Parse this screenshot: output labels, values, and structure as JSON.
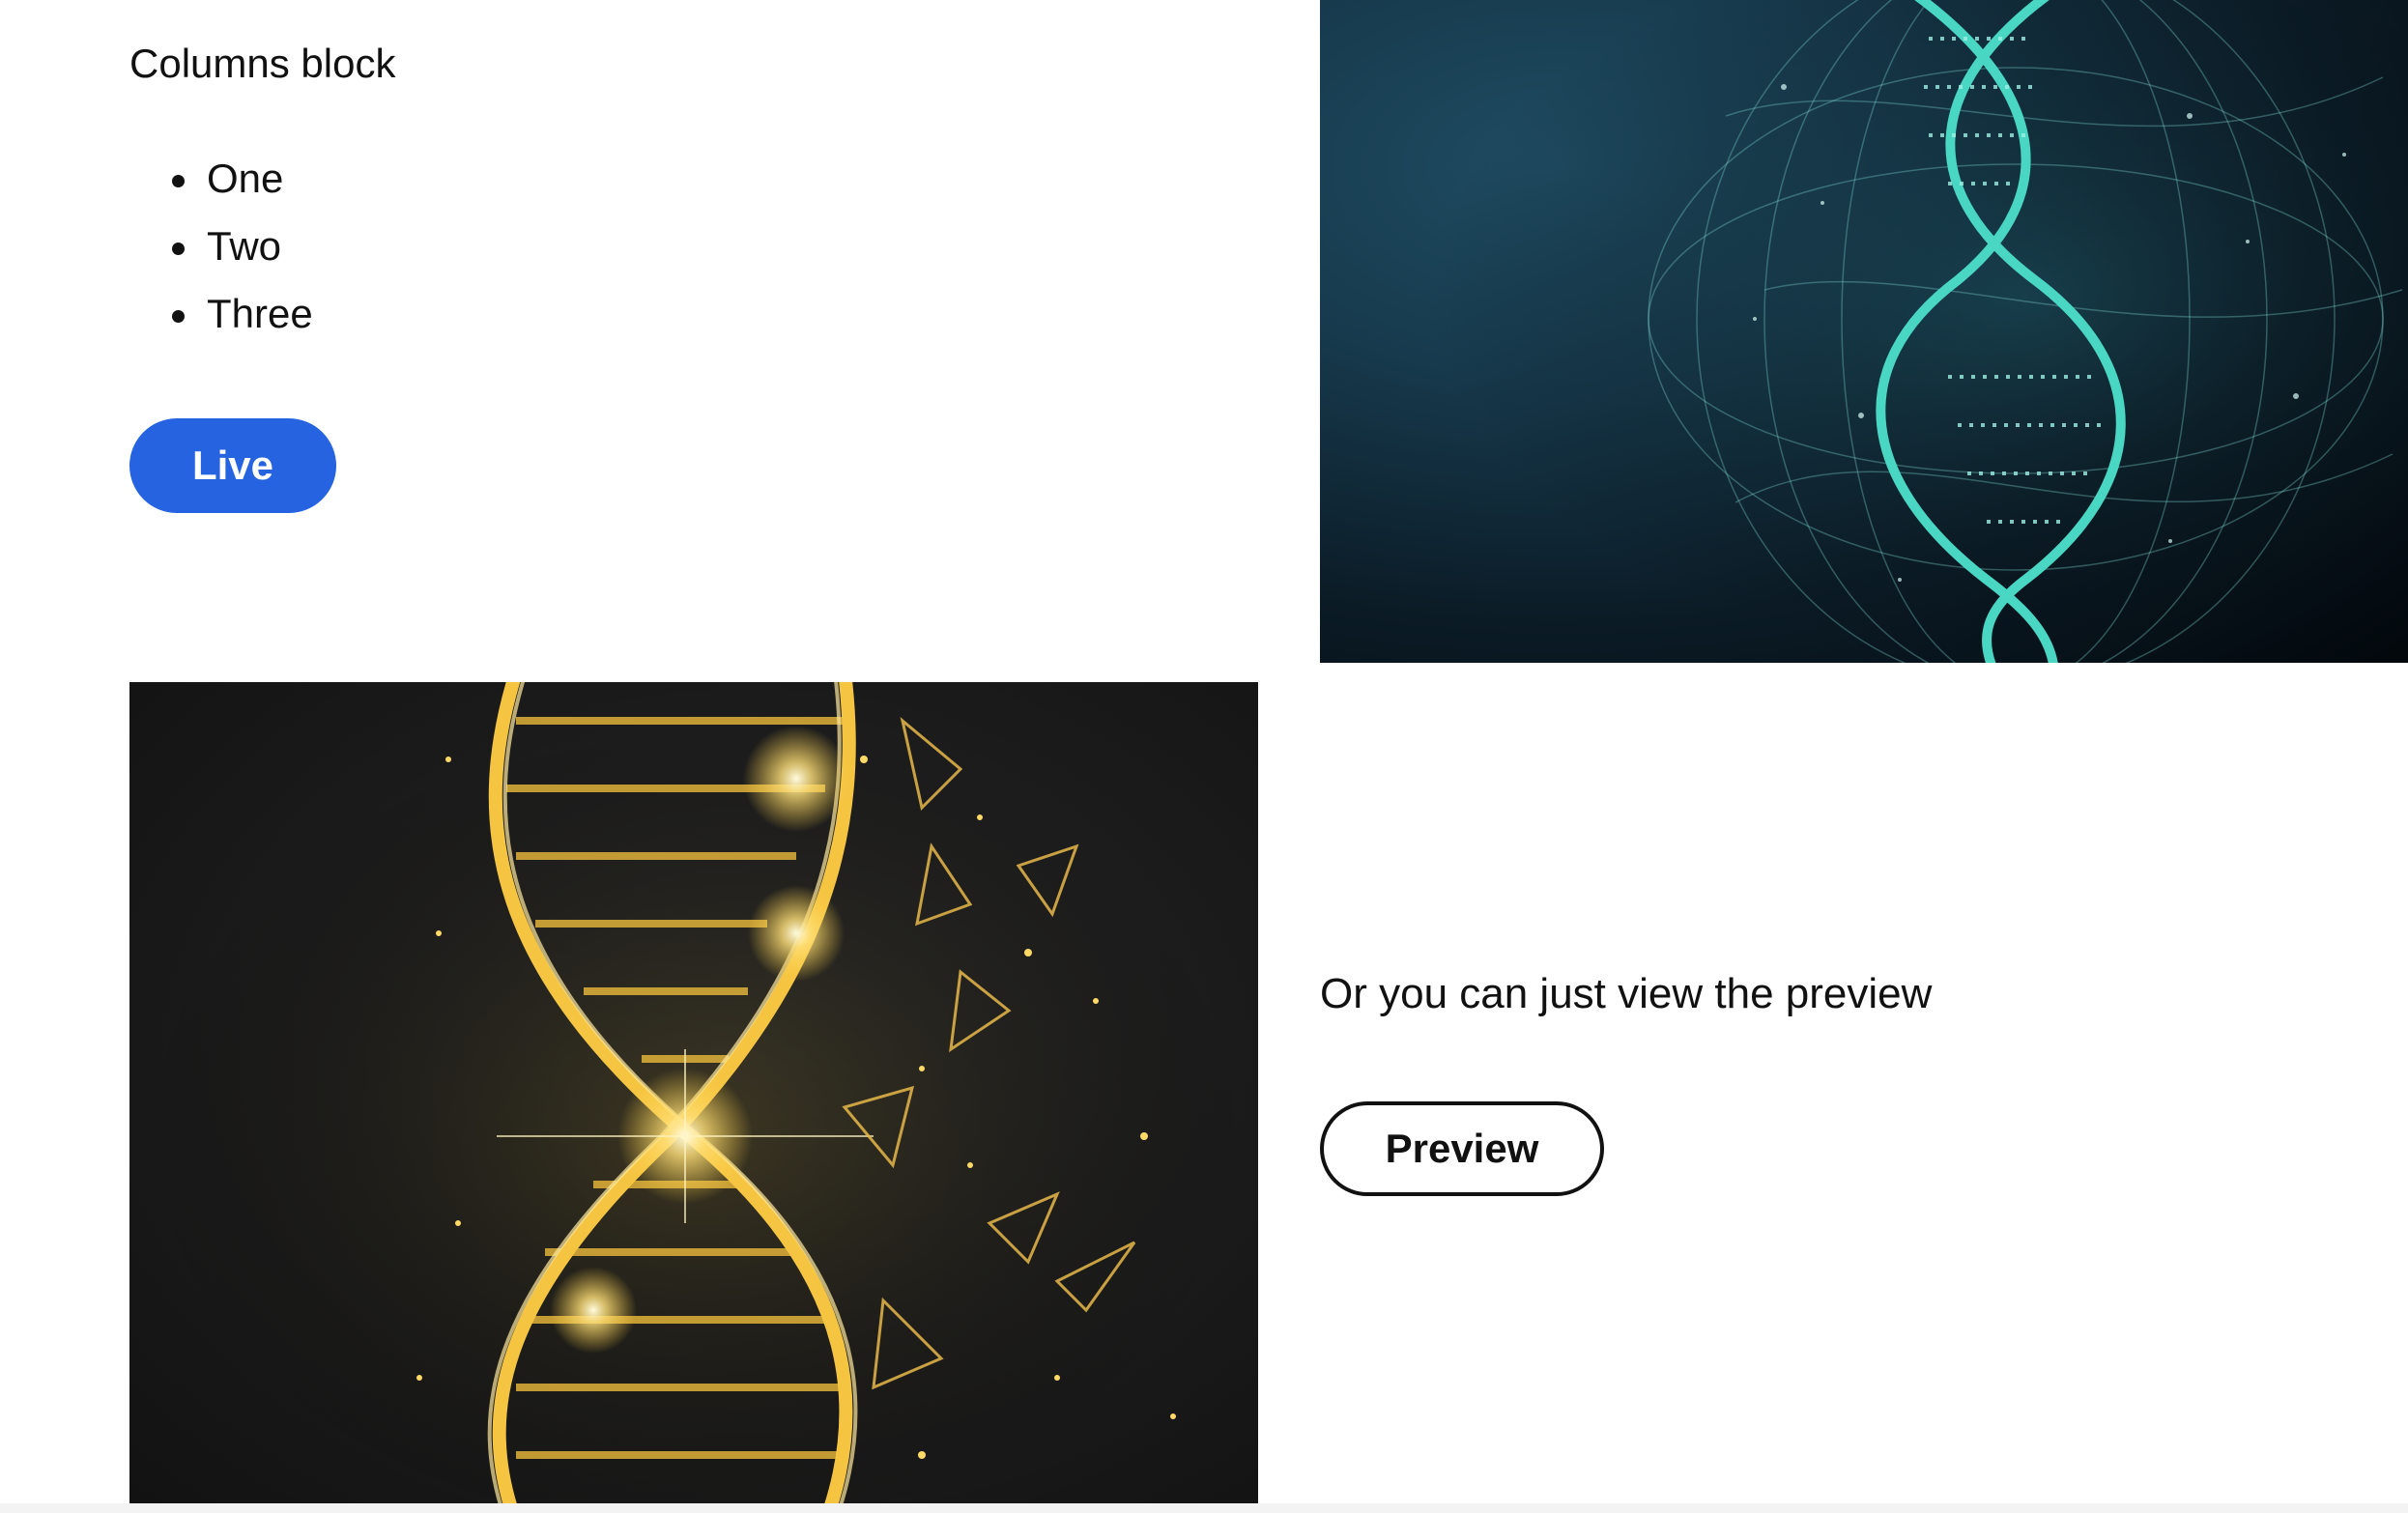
{
  "block": {
    "heading": "Columns block",
    "list_items": [
      "One",
      "Two",
      "Three"
    ],
    "live_button_label": "Live",
    "caption": "Or you can just view the preview",
    "preview_button_label": "Preview"
  },
  "colors": {
    "live_button_bg": "#2563e0",
    "preview_button_border": "#111111",
    "teal_helix": "#49d6c3",
    "gold_helix": "#f5c542"
  },
  "images": {
    "top_right": "teal-dna-helix-image",
    "bottom_left": "gold-dna-helix-image"
  }
}
